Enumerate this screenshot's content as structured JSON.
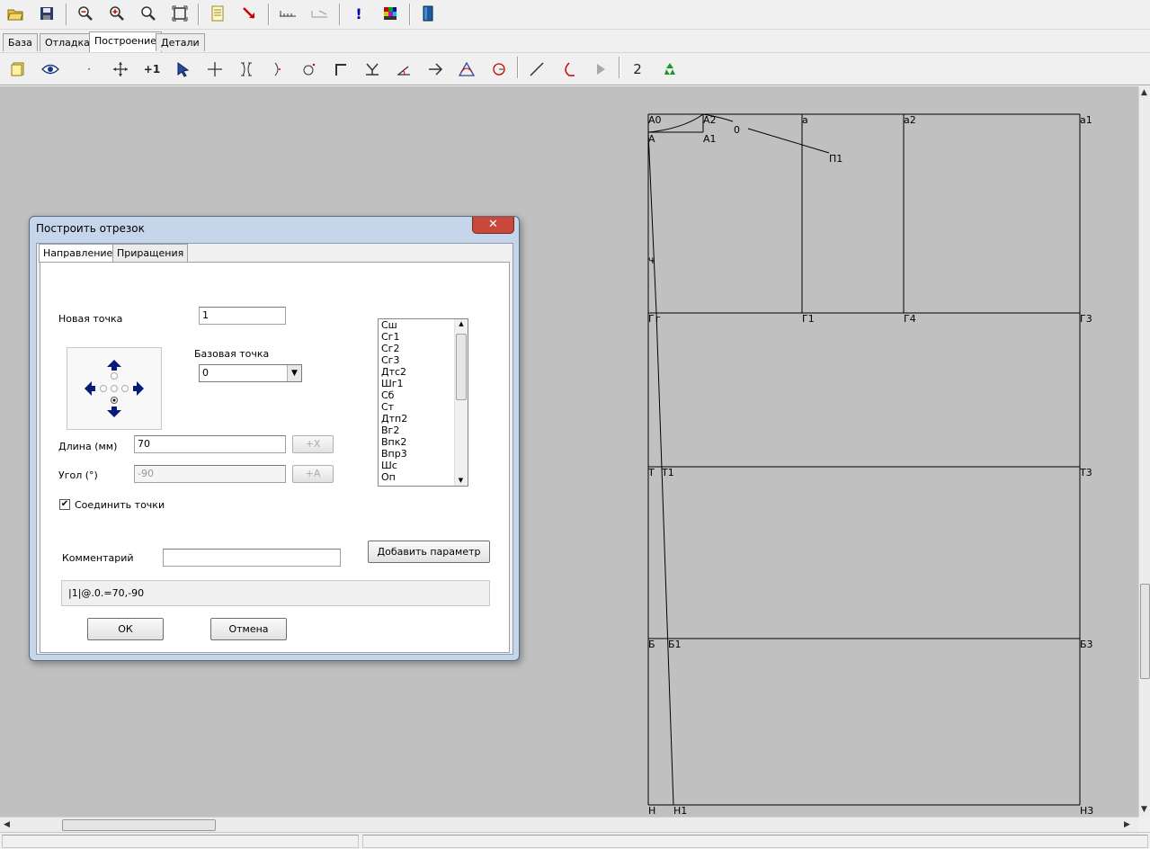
{
  "toolbar_top": {
    "icons": [
      "open-folder-icon",
      "save-icon",
      "zoom-out-icon",
      "zoom-in-icon",
      "zoom-icon",
      "zoom-fit-icon",
      "document-icon",
      "pointer-red-icon",
      "measure-icon",
      "measure-angle-icon",
      "info-icon",
      "palette-icon",
      "book-icon"
    ]
  },
  "mode_tabs": [
    "База",
    "Отладка",
    "Построение",
    "Детали"
  ],
  "mode_tab_active": "Построение",
  "toolbar_build": {
    "icons": [
      "notes-icon",
      "eye-icon",
      "point-icon",
      "move-icon",
      "plus-one-icon",
      "select-icon",
      "cross-icon",
      "bracket-icon",
      "arc-point-icon",
      "circle-point-icon",
      "corner-icon",
      "y-perpendicular-icon",
      "angle-icon",
      "arrow-right-icon",
      "triangle-icon",
      "circle-icon",
      "line-icon",
      "curve-icon",
      "play-icon",
      "recycle-icon"
    ],
    "counter": "2"
  },
  "drawing": {
    "labels": {
      "A0": "А0",
      "A": "А",
      "A2": "А2",
      "A1": "А1",
      "zero": "0",
      "P1": "П1",
      "a": "а",
      "a2": "а2",
      "a1": "а1",
      "ch": "Ч",
      "G": "Г",
      "g": "г",
      "G1": "Г1",
      "G4": "Г4",
      "G3": "Г3",
      "T": "Т",
      "T1": "Т1",
      "T3": "Т3",
      "B": "Б",
      "B1": "Б1",
      "B3": "Б3",
      "N": "Н",
      "N1": "Н1",
      "N3": "Н3"
    }
  },
  "dialog": {
    "title": "Построить отрезок",
    "close": "✕",
    "tabs": [
      "Направление",
      "Приращения"
    ],
    "new_point_label": "Новая точка",
    "new_point_value": "1",
    "base_point_label": "Базовая точка",
    "base_point_value": "0",
    "length_label": "Длина (мм)",
    "length_value": "70",
    "angle_label": "Угол (°)",
    "angle_value": "-90",
    "plus_x": "+X",
    "plus_a": "+A",
    "connect_label": "Соединить точки",
    "connect_checked": true,
    "comment_label": "Комментарий",
    "comment_value": "",
    "add_param_button": "Добавить параметр",
    "formula": "|1|@.0.=70,-90",
    "ok_button": "ОК",
    "cancel_button": "Отмена",
    "params": [
      "Сш",
      "Сг1",
      "Сг2",
      "Сг3",
      "Дтс2",
      "Шг1",
      "Сб",
      "Ст",
      "Дтп2",
      "Вг2",
      "Впк2",
      "Впр3",
      "Шс",
      "Оп"
    ]
  }
}
